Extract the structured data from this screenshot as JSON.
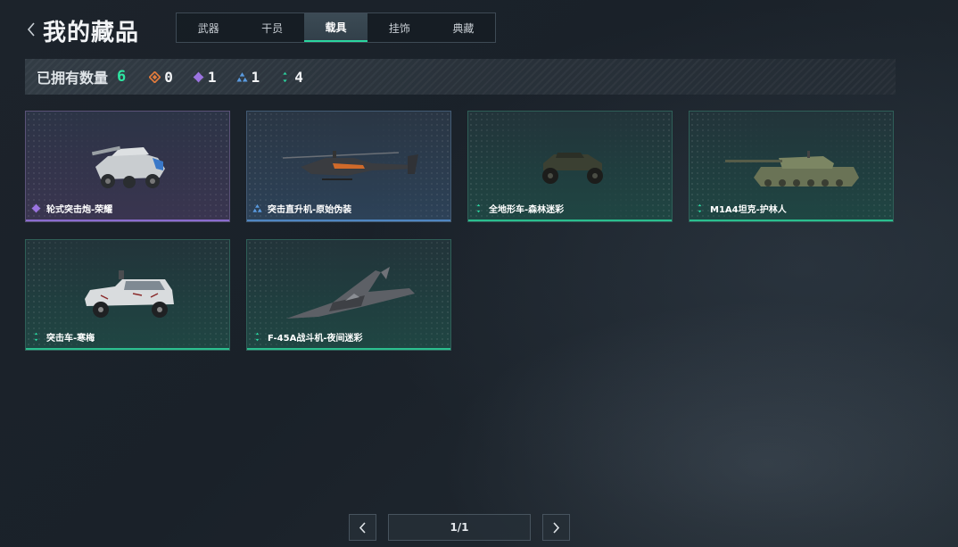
{
  "header": {
    "title": "我的藏品"
  },
  "tabs": [
    {
      "label": "武器",
      "active": false
    },
    {
      "label": "干员",
      "active": false
    },
    {
      "label": "载具",
      "active": true
    },
    {
      "label": "挂饰",
      "active": false
    },
    {
      "label": "典藏",
      "active": false
    }
  ],
  "summary": {
    "label": "已拥有数量",
    "total": "6",
    "rarities": [
      {
        "icon": "orange-diamond-icon",
        "color": "#e07a3c",
        "count": "0"
      },
      {
        "icon": "purple-diamond-icon",
        "color": "#9b74e0",
        "count": "1"
      },
      {
        "icon": "blue-triangle-icon",
        "color": "#5a9be0",
        "count": "1"
      },
      {
        "icon": "green-dots-icon",
        "color": "#2bd6a0",
        "count": "4"
      }
    ]
  },
  "items": [
    {
      "name": "轮式突击炮-荣耀",
      "rarity": "purple",
      "icon": "purple-diamond-icon",
      "image": "wheeled-assault-gun"
    },
    {
      "name": "突击直升机-原始伪装",
      "rarity": "blue",
      "icon": "blue-triangle-icon",
      "image": "attack-helicopter"
    },
    {
      "name": "全地形车-森林迷彩",
      "rarity": "green",
      "icon": "green-dots-icon",
      "image": "atv"
    },
    {
      "name": "M1A4坦克-护林人",
      "rarity": "green",
      "icon": "green-dots-icon",
      "image": "tank"
    },
    {
      "name": "突击车-寒梅",
      "rarity": "green",
      "icon": "green-dots-icon",
      "image": "assault-vehicle"
    },
    {
      "name": "F-45A战斗机-夜间迷彩",
      "rarity": "green",
      "icon": "green-dots-icon",
      "image": "fighter-jet"
    }
  ],
  "pagination": {
    "text": "1/1"
  },
  "colors": {
    "accent": "#2bd6a0",
    "purple": "#8a6ccf",
    "blue": "#4f86c2",
    "green": "#2bbf8f"
  }
}
